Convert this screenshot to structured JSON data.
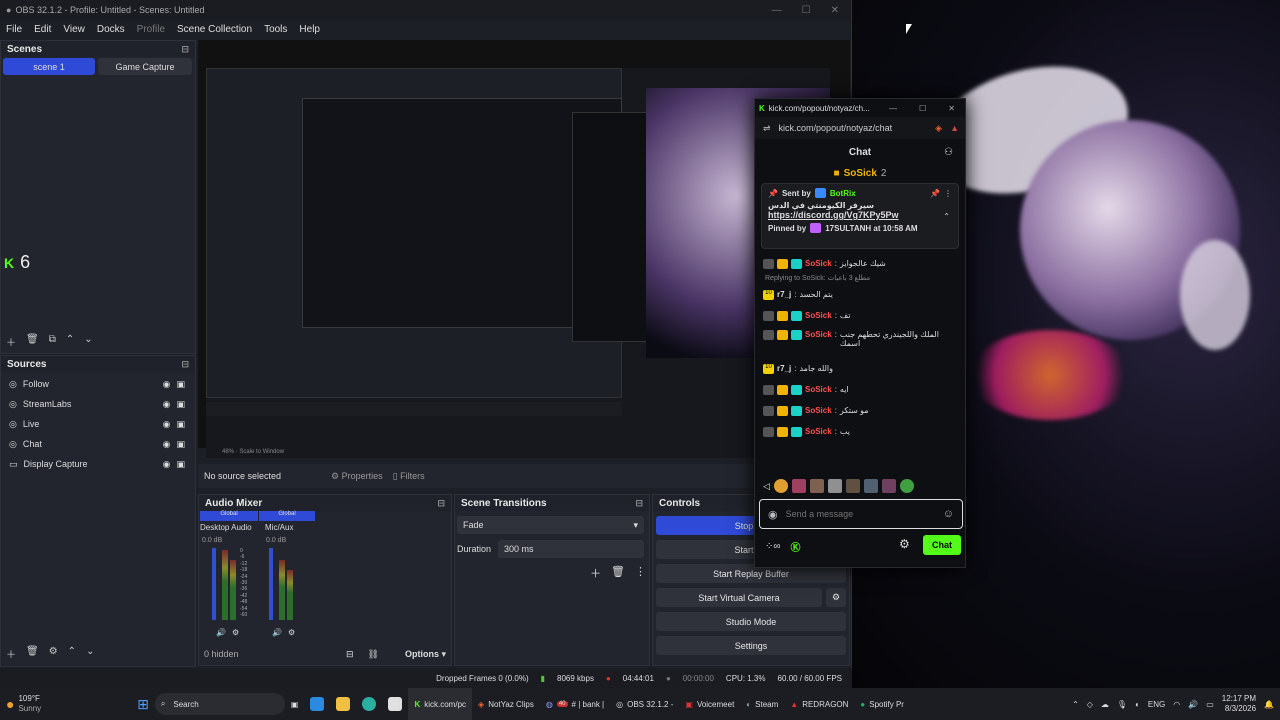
{
  "obs": {
    "title": "OBS 32.1.2 - Profile: Untitled - Scenes: Untitled",
    "menu": [
      "File",
      "Edit",
      "View",
      "Docks",
      "Profile",
      "Scene Collection",
      "Tools",
      "Help"
    ],
    "scenes_header": "Scenes",
    "scenes": [
      "scene 1",
      "Game Capture"
    ],
    "sources_header": "Sources",
    "sources": [
      "Follow",
      "StreamLabs",
      "Live",
      "Chat",
      "Display Capture"
    ],
    "follow_count": "6",
    "no_source": "No source selected",
    "properties": "Properties",
    "filters": "Filters",
    "audio_header": "Audio Mixer",
    "audio": [
      {
        "scope": "Global",
        "name": "Desktop Audio",
        "db": "0.0 dB"
      },
      {
        "scope": "Global",
        "name": "Mic/Aux",
        "db": "0.0 dB"
      }
    ],
    "db_ticks": [
      "0",
      "-6",
      "-12",
      "-18",
      "-24",
      "-30",
      "-36",
      "-42",
      "-48",
      "-54",
      "-60"
    ],
    "hidden": "0 hidden",
    "options": "Options",
    "trans_header": "Scene Transitions",
    "transition": "Fade",
    "duration_label": "Duration",
    "duration": "300 ms",
    "controls_header": "Controls",
    "controls": [
      "Stop Str",
      "Start Re",
      "Start Replay Buffer",
      "Start Virtual Camera",
      "Studio Mode",
      "Settings"
    ],
    "status": {
      "dropped": "Dropped Frames 0 (0.0%)",
      "kbps": "8069 kbps",
      "time1": "04:44:01",
      "time2": "00:00:00",
      "cpu": "CPU: 1.3%",
      "fps": "60.00 / 60.00 FPS"
    }
  },
  "kick": {
    "tab": "kick.com/popout/notyaz/ch...",
    "url": "kick.com/popout/notyaz/chat",
    "header": "Chat",
    "top_user": "SoSick",
    "top_count": "2",
    "pinned_sent": "Sent by",
    "pinned_bot": "BotRix",
    "pinned_text": "سيرفر الكيومنتي في الدس",
    "pinned_link": "https://discord.gg/Vg7KPy5Pw",
    "pinned_by": "Pinned by",
    "pinned_user": "17SULTANH at 10:58 AM",
    "reply": "Replying to SoSick: مطلع 3 باعيات",
    "messages": [
      {
        "user": "",
        "text": "شيك عالجوايز"
      },
      {
        "user": "r7_j",
        "text": "يتم الحسد"
      },
      {
        "user": "SoSick",
        "text": "تف"
      },
      {
        "user": "SoSick",
        "text": "الملك واللجيندري تحطهم جنب اسمك"
      },
      {
        "user": "r7_j",
        "text": "والله جامد"
      },
      {
        "user": "SoSick",
        "text": "ايه"
      },
      {
        "user": "SoSick",
        "text": "مو ستكر"
      },
      {
        "user": "SoSick",
        "text": "يب"
      }
    ],
    "placeholder": "Send a message",
    "chat_button": "Chat"
  },
  "taskbar": {
    "weather_temp": "109°F",
    "weather_desc": "Sunny",
    "search": "Search",
    "apps": [
      "kick.com/pc",
      "NotYaz Clips",
      "# | bank |",
      "OBS 32.1.2 -",
      "Voicemeet",
      "Steam",
      "REDRAGON",
      "Spotify Pr"
    ],
    "badge": "40",
    "lang": "ENG",
    "time": "12:17 PM",
    "date": "8/3/2026"
  },
  "colors": {
    "accent": "#2f4ad6",
    "kick": "#53fc18",
    "sosick": "#ff4f4f"
  }
}
